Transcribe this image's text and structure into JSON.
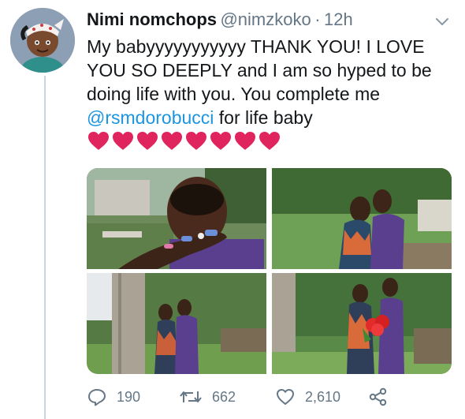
{
  "tweet": {
    "author": {
      "display_name": "Nimi nomchops",
      "handle": "@nimzkoko",
      "separator": "·",
      "time": "12h",
      "avatar_icon": "cartoon-avatar"
    },
    "text": {
      "part1": "My babyyyyyyyyyyy THANK YOU! I LOVE YOU SO DEEPLY and I am so hyped to be doing life with you. You complete me ",
      "mention": "@rsmdorobucci",
      "part2": " for life baby ",
      "heart_count": 8,
      "heart_color": "#e0245e"
    },
    "media": {
      "photos": [
        {
          "icon": "photo-ring-hand"
        },
        {
          "icon": "photo-couple-kiss"
        },
        {
          "icon": "photo-couple-tree"
        },
        {
          "icon": "photo-couple-flowers"
        }
      ]
    },
    "actions": {
      "reply_count": "190",
      "retweet_count": "662",
      "like_count": "2,610",
      "share_icon": "share-icon"
    },
    "colors": {
      "link": "#1b95e0",
      "secondary_text": "#657786",
      "thread_line": "#ccd6dd"
    }
  }
}
